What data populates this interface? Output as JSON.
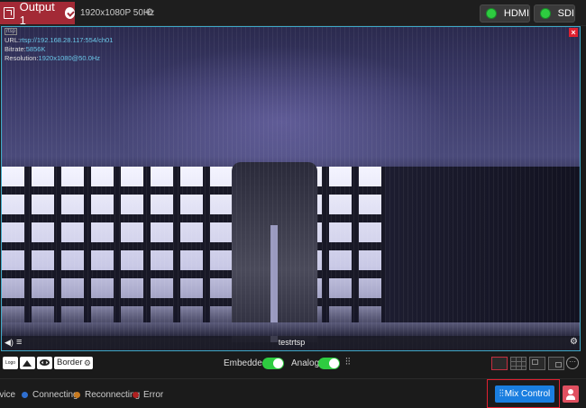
{
  "header": {
    "output_title": "Output 1",
    "resolution": "1920x1080P 50Hz",
    "ports": [
      {
        "label": "HDMI",
        "status_color": "#2ecc40"
      },
      {
        "label": "SDI",
        "status_color": "#2ecc40"
      }
    ]
  },
  "preview": {
    "tag": "rtsp",
    "url_label": "URL:",
    "url_value": "rtsp://192.168.28.117:554/ch01",
    "bitrate_label": "Bitrate:",
    "bitrate_value": "5856K",
    "resolution_label": "Resolution:",
    "resolution_value": "1920x1080@50.0Hz",
    "close_icon": "×",
    "source_name": "testrtsp"
  },
  "controls": {
    "logo_label": "Logo",
    "border_label": "Border",
    "embedded_label": "Embedded",
    "embedded_on": true,
    "analog_label": "Analog",
    "analog_on": true,
    "more_label": "···"
  },
  "status_legend": [
    {
      "label": "rvice",
      "color": "#cccccc"
    },
    {
      "label": "Connecting",
      "color": "#2f6fd0"
    },
    {
      "label": "Reconnecting",
      "color": "#c77a20"
    },
    {
      "label": "Error",
      "color": "#b02020"
    }
  ],
  "footer": {
    "mix_control_label": "Mix Control",
    "accent": "#1a7ee0",
    "highlight": "#e02030"
  }
}
